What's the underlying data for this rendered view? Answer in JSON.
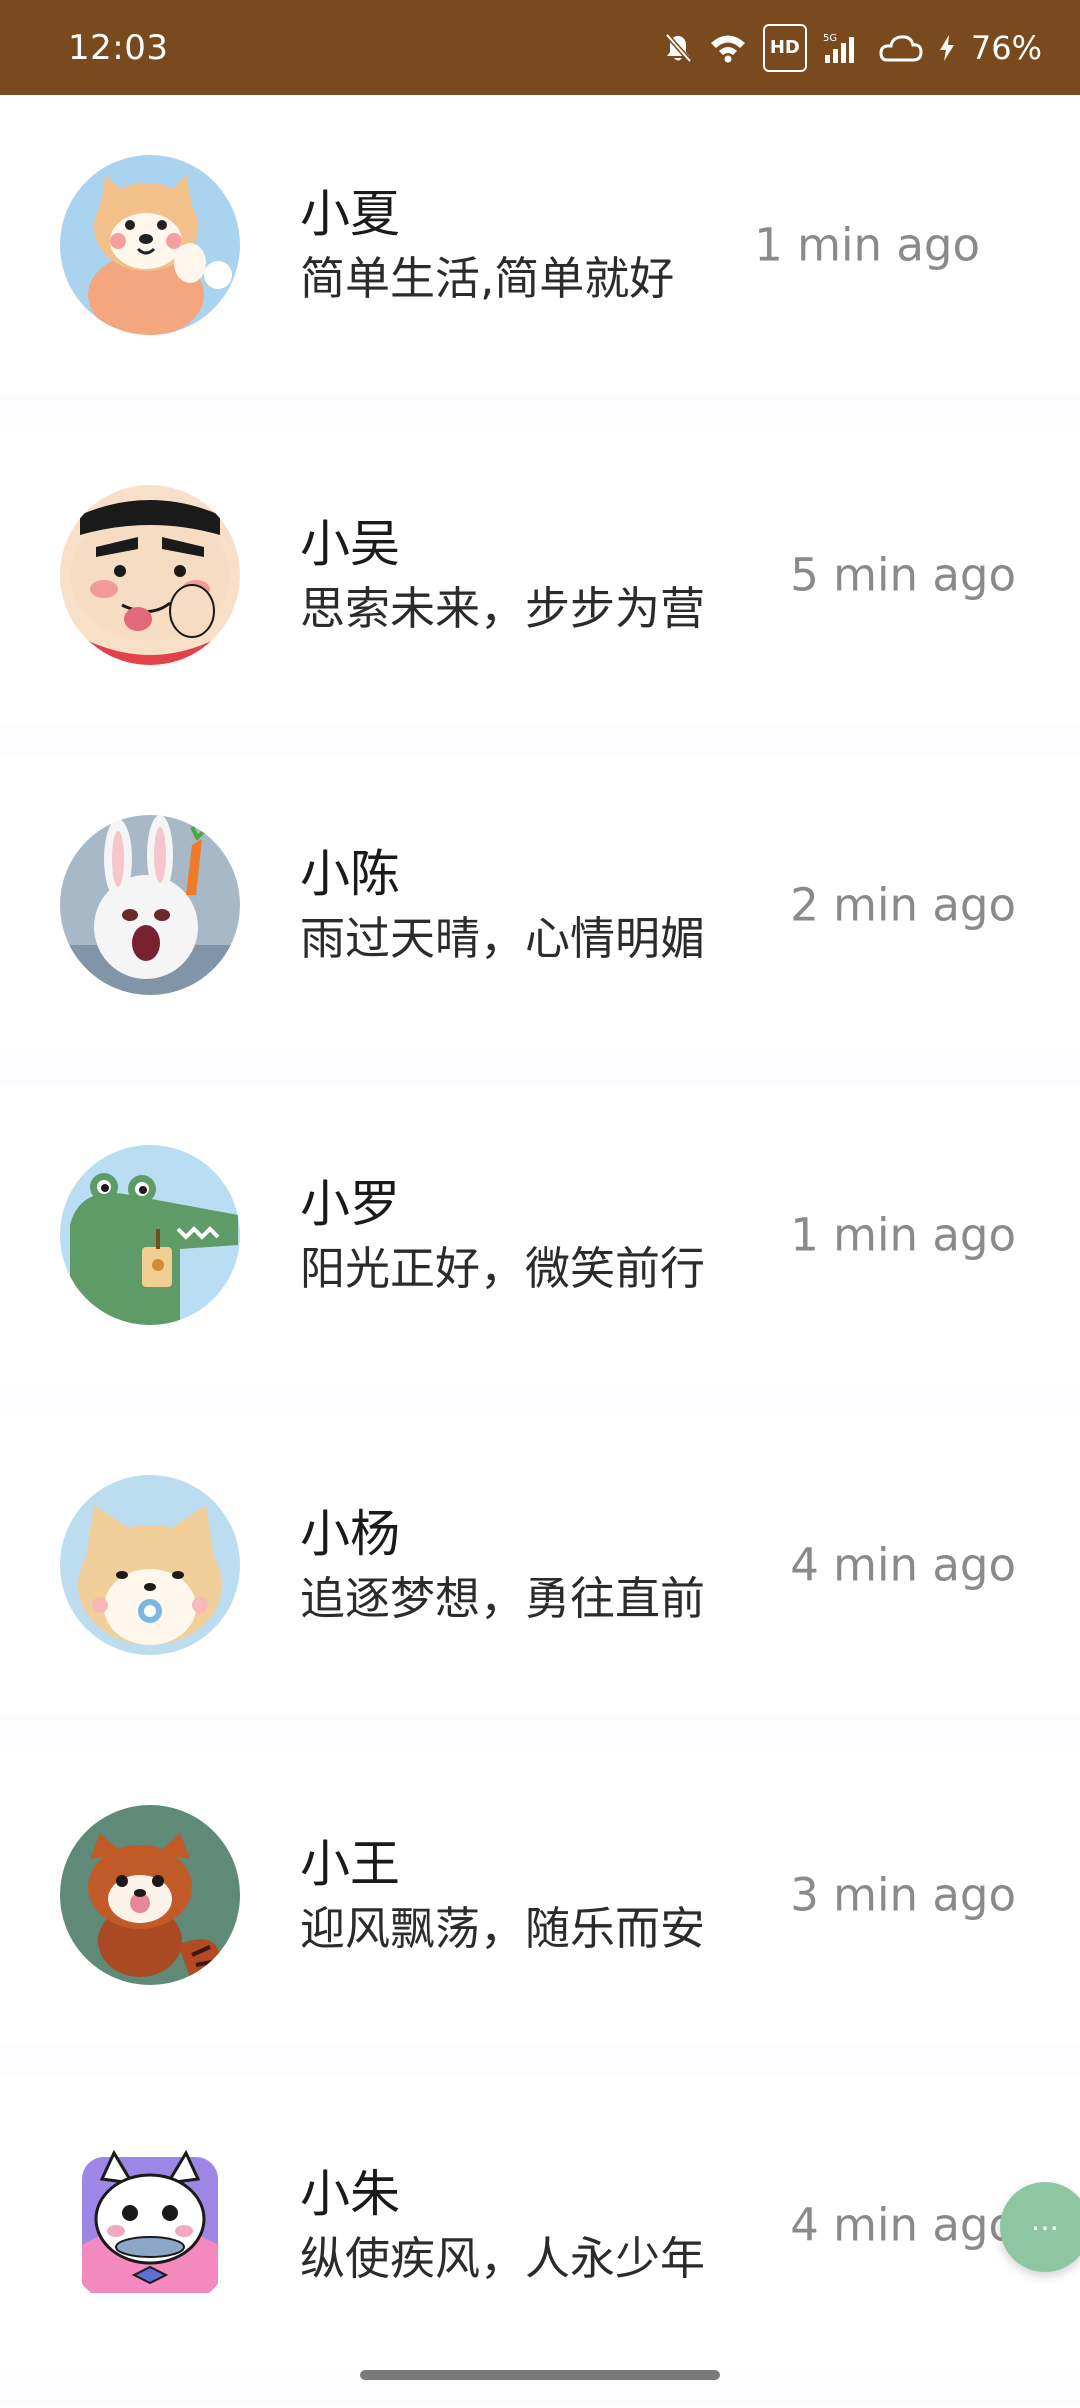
{
  "status_bar": {
    "time": "12:03",
    "battery": "76%",
    "hd_label": "HD",
    "network_label": "5G",
    "background_color": "#7a4a1f"
  },
  "chats": [
    {
      "name": "小夏",
      "message": "简单生活,简单就好",
      "time": "1 min ago",
      "avatar_icon": "shiba-avatar-icon"
    },
    {
      "name": "小吴",
      "message": "思索未来，步步为营",
      "time": "5 min ago",
      "avatar_icon": "crayon-boy-avatar-icon"
    },
    {
      "name": "小陈",
      "message": "雨过天晴，心情明媚",
      "time": "2 min ago",
      "avatar_icon": "rabbit-avatar-icon"
    },
    {
      "name": "小罗",
      "message": "阳光正好，微笑前行",
      "time": "1 min ago",
      "avatar_icon": "crocodile-avatar-icon"
    },
    {
      "name": "小杨",
      "message": "追逐梦想，勇往直前",
      "time": "4 min ago",
      "avatar_icon": "puppy-avatar-icon"
    },
    {
      "name": "小王",
      "message": "迎风飘荡，随乐而安",
      "time": "3 min ago",
      "avatar_icon": "red-panda-avatar-icon"
    },
    {
      "name": "小朱",
      "message": "纵使疾风，人永少年",
      "time": "4 min ago",
      "avatar_icon": "cat-avatar-icon"
    }
  ]
}
